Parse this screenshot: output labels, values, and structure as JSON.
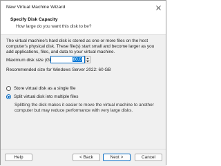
{
  "window": {
    "title": "New Virtual Machine Wizard"
  },
  "header": {
    "title": "Specify Disk Capacity",
    "subtitle": "How large do you want this disk to be?"
  },
  "body": {
    "description": "The virtual machine's hard disk is stored as one or more files on the host computer's physical disk. These file(s) start small and become larger as you add applications, files, and data to your virtual machine.",
    "max_size_label": "Maximum disk size (GB):",
    "max_size_value": "60.0",
    "recommended": "Recommended size for Windows Server 2022: 60 GB",
    "options": [
      {
        "label": "Store virtual disk as a single file",
        "selected": false
      },
      {
        "label": "Split virtual disk into multiple files",
        "selected": true
      }
    ],
    "split_description": "Splitting the disk makes it easier to move the virtual machine to another computer but may reduce performance with very large disks."
  },
  "footer": {
    "help": "Help",
    "back": "< Back",
    "next": "Next >",
    "cancel": "Cancel"
  },
  "colors": {
    "accent": "#0067c0",
    "panel": "#f0f0f0"
  }
}
